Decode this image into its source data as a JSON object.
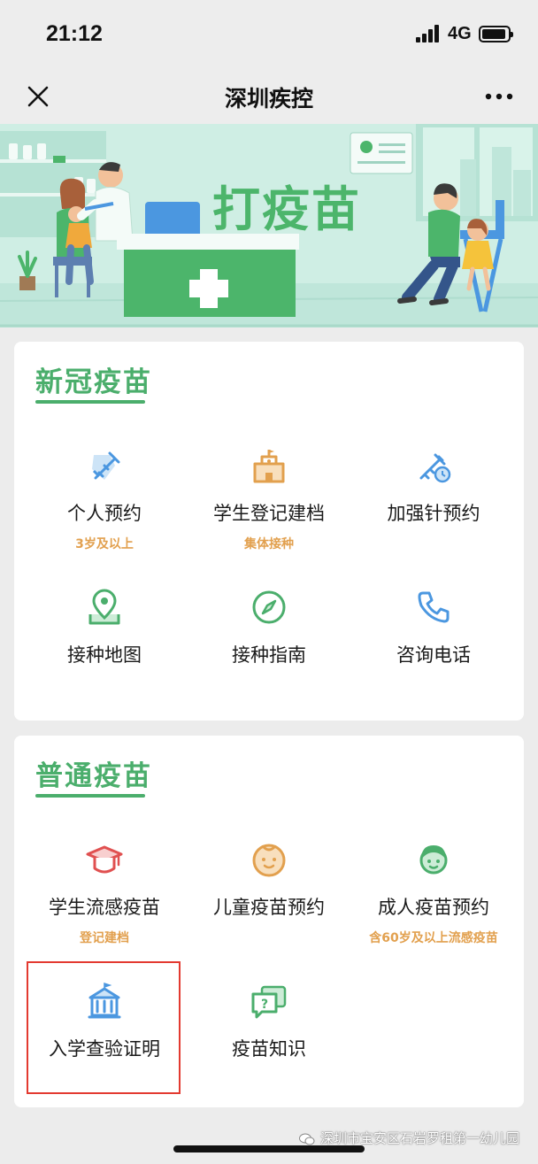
{
  "status_bar": {
    "time": "21:12",
    "network": "4G"
  },
  "nav": {
    "title": "深圳疾控"
  },
  "banner": {
    "title": "打疫苗"
  },
  "covid_section": {
    "title": "新冠疫苗",
    "items": [
      {
        "label": "个人预约",
        "sub": "3岁及以上",
        "icon": "vaccine-syringe-icon"
      },
      {
        "label": "学生登记建档",
        "sub": "集体接种",
        "icon": "school-building-icon"
      },
      {
        "label": "加强针预约",
        "sub": "",
        "icon": "syringe-clock-icon"
      },
      {
        "label": "接种地图",
        "sub": "",
        "icon": "map-pin-icon"
      },
      {
        "label": "接种指南",
        "sub": "",
        "icon": "compass-icon"
      },
      {
        "label": "咨询电话",
        "sub": "",
        "icon": "phone-icon"
      }
    ]
  },
  "general_section": {
    "title": "普通疫苗",
    "items": [
      {
        "label": "学生流感疫苗",
        "sub": "登记建档",
        "icon": "graduation-cap-icon"
      },
      {
        "label": "儿童疫苗预约",
        "sub": "",
        "icon": "child-face-icon"
      },
      {
        "label": "成人疫苗预约",
        "sub": "含60岁及以上流感疫苗",
        "icon": "adult-face-icon"
      },
      {
        "label": "入学查验证明",
        "sub": "",
        "icon": "school-icon"
      },
      {
        "label": "疫苗知识",
        "sub": "",
        "icon": "question-chat-icon"
      }
    ]
  },
  "watermark": {
    "text": "深圳市宝安区石岩罗租第一幼儿园"
  },
  "colors": {
    "green": "#4bae6c",
    "orange": "#e2a04e",
    "blue": "#4b97e0",
    "red": "#e05050",
    "highlight": "#e33a30"
  }
}
